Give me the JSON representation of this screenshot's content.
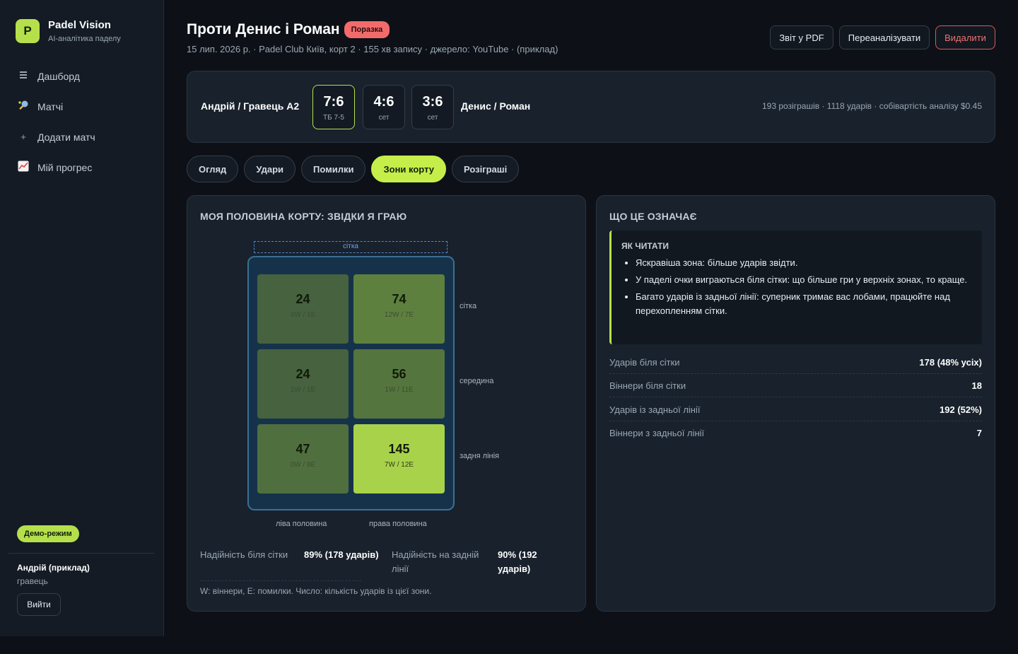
{
  "brand": {
    "logo_letter": "P",
    "name": "Padel Vision",
    "subtitle": "AI-аналітика паделу"
  },
  "nav": [
    {
      "icon": "dashboard-icon",
      "label": "Дашборд"
    },
    {
      "icon": "racket-icon",
      "label": "Матчі"
    },
    {
      "icon": "plus-icon",
      "label": "Додати матч"
    },
    {
      "icon": "chart-icon",
      "label": "Мій прогрес"
    }
  ],
  "sidebar_footer": {
    "demo_badge": "Демо-режим",
    "user_name": "Андрій (приклад)",
    "user_role": "гравець",
    "logout": "Вийти"
  },
  "header": {
    "title": "Проти Денис і Роман",
    "result_badge": "Поразка",
    "meta": "15 лип. 2026 р. · Padel Club Київ, корт 2 · 155 хв запису · джерело: YouTube · (приклад)",
    "buttons": {
      "pdf": "Звіт у PDF",
      "reanalyze": "Переаналізувати",
      "delete": "Видалити"
    }
  },
  "score": {
    "team_left": "Андрій / Гравець А2",
    "team_right": "Денис / Роман",
    "sets": [
      {
        "score": "7:6",
        "sub": "ТБ 7-5",
        "won": true
      },
      {
        "score": "4:6",
        "sub": "сет",
        "won": false
      },
      {
        "score": "3:6",
        "sub": "сет",
        "won": false
      }
    ],
    "summary": "193 розіграшів · 1118 ударів · собівартість аналізу $0.45"
  },
  "tabs": [
    {
      "label": "Огляд",
      "active": false
    },
    {
      "label": "Удари",
      "active": false
    },
    {
      "label": "Помилки",
      "active": false
    },
    {
      "label": "Зони корту",
      "active": true
    },
    {
      "label": "Розіграші",
      "active": false
    }
  ],
  "court": {
    "title": "МОЯ ПОЛОВИНА КОРТУ: ЗВІДКИ Я ГРАЮ",
    "net_label": "сітка",
    "row_labels": [
      "сітка",
      "середина",
      "задня лінія"
    ],
    "col_labels": [
      "ліва половина",
      "права половина"
    ],
    "colors": {
      "low": "#3b5440",
      "mid": "#5c7e3e",
      "high": "#a9d24b"
    },
    "zones": [
      {
        "count": "24",
        "we": "4W / 1E",
        "intensity": 0.17
      },
      {
        "count": "74",
        "we": "12W / 7E",
        "intensity": 0.51
      },
      {
        "count": "24",
        "we": "1W / 1E",
        "intensity": 0.17
      },
      {
        "count": "56",
        "we": "1W / 11E",
        "intensity": 0.39
      },
      {
        "count": "47",
        "we": "0W / 8E",
        "intensity": 0.32
      },
      {
        "count": "145",
        "we": "7W / 12E",
        "intensity": 1.0
      }
    ],
    "reliability": {
      "net_label": "Надійність біля сітки",
      "net_value": "89% (178 ударів)",
      "back_label": "Надійність на задній лінії",
      "back_value": "90% (192 ударів)"
    },
    "legend": "W: віннери, E: помилки. Число: кількість ударів із цієї зони."
  },
  "info": {
    "title": "ЩО ЦЕ ОЗНАЧАЄ",
    "howto_title": "ЯК ЧИТАТИ",
    "bullets": [
      "Яскравіша зона: більше ударів звідти.",
      "У паделі очки виграються біля сітки: що більше гри у верхніх зонах, то краще.",
      "Багато ударів із задньої лінії: суперник тримає вас лобами, працюйте над перехопленням сітки."
    ],
    "stats": [
      {
        "label": "Ударів біля сітки",
        "value": "178 (48% усіх)"
      },
      {
        "label": "Віннери біля сітки",
        "value": "18"
      },
      {
        "label": "Ударів із задньої лінії",
        "value": "192 (52%)"
      },
      {
        "label": "Віннери з задньої лінії",
        "value": "7"
      }
    ]
  }
}
